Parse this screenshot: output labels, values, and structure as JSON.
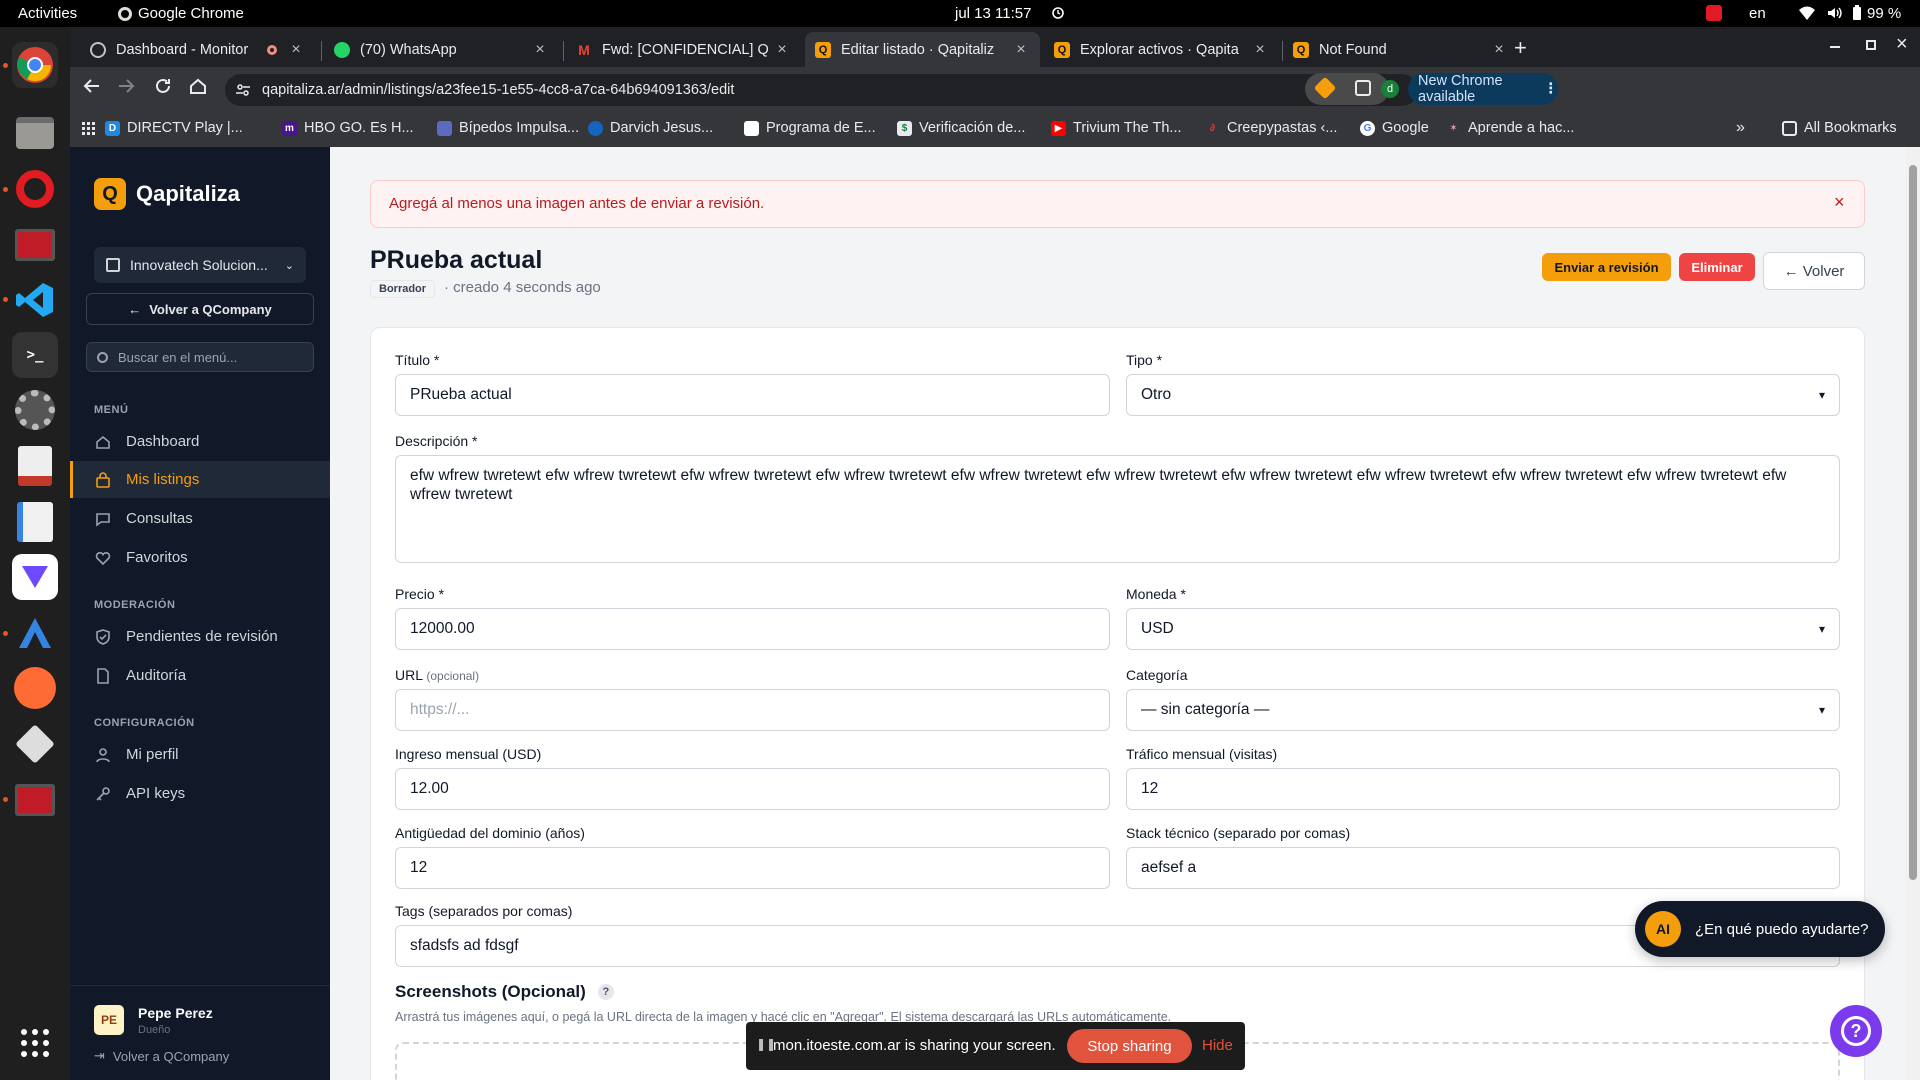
{
  "topbar": {
    "activities": "Activities",
    "app": "Google Chrome",
    "datetime": "jul 13  11:57",
    "lang": "en",
    "battery": "99 %"
  },
  "tabs": [
    {
      "title": "Dashboard - Monitor",
      "icon": "globe-icon"
    },
    {
      "title": "(70) WhatsApp",
      "icon": "whatsapp-icon"
    },
    {
      "title": "Fwd: [CONFIDENCIAL] Q",
      "icon": "gmail-icon"
    },
    {
      "title": "Editar listado · Qapitaliz",
      "icon": "qapitaliza-icon"
    },
    {
      "title": "Explorar activos · Qapita",
      "icon": "qapitaliza-icon"
    },
    {
      "title": "Not Found",
      "icon": "qapitaliza-icon"
    }
  ],
  "address": {
    "url": "qapitaliza.ar/admin/listings/a23fee15-1e55-4cc8-a7ca-64b694091363/edit",
    "profile_initial": "d",
    "update_label": "New Chrome available"
  },
  "bookmarks": [
    "DIRECTV Play |...",
    "HBO GO. Es H...",
    "Bípedos Impulsa...",
    "Darvich Jesus...",
    "Programa de E...",
    "Verificación de...",
    "Trivium The Th...",
    "Creepypastas ‹...",
    "Google",
    "Aprende a hac..."
  ],
  "bookmarks_all": "All Bookmarks",
  "sidebar": {
    "brand": "Qapitaliza",
    "brand_letter": "Q",
    "company": "Innovatech Solucion...",
    "back_button": "Volver a QCompany",
    "search_placeholder": "Buscar en el menú...",
    "sections": {
      "menu": "MENÚ",
      "moderation": "MODERACIÓN",
      "config": "CONFIGURACIÓN"
    },
    "items": {
      "dashboard": "Dashboard",
      "listings": "Mis listings",
      "consultas": "Consultas",
      "favoritos": "Favoritos",
      "pendientes": "Pendientes de revisión",
      "auditoria": "Auditoría",
      "perfil": "Mi perfil",
      "apikeys": "API keys"
    },
    "user": {
      "initials": "PE",
      "name": "Pepe Perez",
      "role": "Dueño",
      "back": "Volver a QCompany"
    }
  },
  "alert": {
    "message": "Agregá al menos una imagen antes de enviar a revisión.",
    "close": "×"
  },
  "page": {
    "title": "PRueba actual",
    "status_badge": "Borrador",
    "created": "· creado 4 seconds ago",
    "submit_button": "Enviar a revisión",
    "delete_button": "Eliminar",
    "back_button": "← Volver"
  },
  "form": {
    "titulo": {
      "label": "Título *",
      "value": "PRueba actual"
    },
    "tipo": {
      "label": "Tipo *",
      "value": "Otro"
    },
    "descripcion": {
      "label": "Descripción *",
      "value": "efw wfrew twretewt efw wfrew twretewt efw wfrew twretewt efw wfrew twretewt efw wfrew twretewt efw wfrew twretewt efw wfrew twretewt efw wfrew twretewt efw wfrew twretewt efw wfrew twretewt efw wfrew twretewt"
    },
    "precio": {
      "label": "Precio *",
      "value": "12000.00"
    },
    "moneda": {
      "label": "Moneda *",
      "value": "USD"
    },
    "url": {
      "label": "URL",
      "optional": "(opcional)",
      "placeholder": "https://..."
    },
    "categoria": {
      "label": "Categoría",
      "value": "— sin categoría —"
    },
    "ingreso": {
      "label": "Ingreso mensual (USD)",
      "value": "12.00"
    },
    "trafico": {
      "label": "Tráfico mensual (visitas)",
      "value": "12"
    },
    "antiguedad": {
      "label": "Antigüedad del dominio (años)",
      "value": "12"
    },
    "stack": {
      "label": "Stack técnico (separado por comas)",
      "value": "aefsef a"
    },
    "tags": {
      "label": "Tags (separados por comas)",
      "value": "sfadsfs ad fdsgf"
    },
    "screenshots": {
      "title": "Screenshots (Opcional)",
      "help": "?",
      "hint": "Arrastrá tus imágenes aquí, o pegá la URL directa de la imagen y hacé clic en \"Agregar\". El sistema descargará las URLs automáticamente."
    }
  },
  "ai_chat": {
    "badge": "AI",
    "text": "¿En qué puedo ayudarte?"
  },
  "share_bar": {
    "text": "mon.itoeste.com.ar is sharing your screen.",
    "stop": "Stop sharing",
    "hide": "Hide"
  },
  "colors": {
    "brand": "#f59e0b",
    "danger": "#ef4444",
    "sidebar": "#111827",
    "ai_fab": "#7c3aed"
  }
}
